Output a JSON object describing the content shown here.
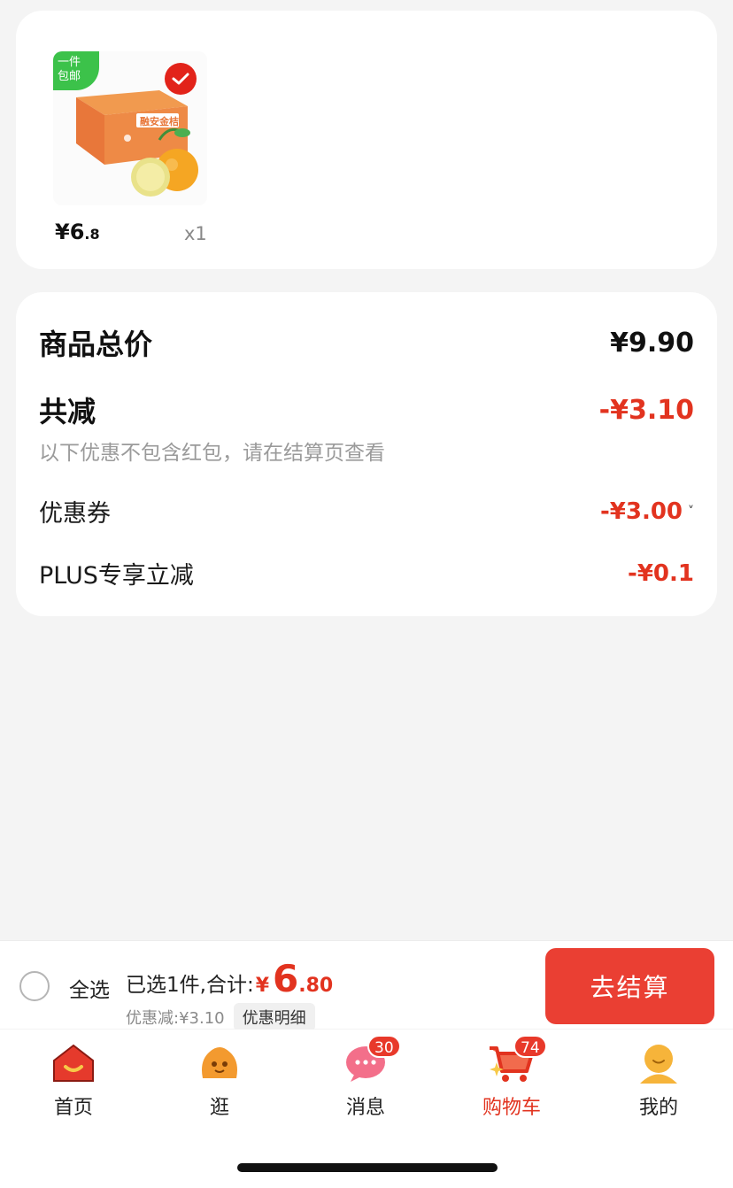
{
  "product": {
    "badge_line1": "一件",
    "badge_line2": "包邮",
    "price_symbol": "¥",
    "price_int": "6",
    "price_dec": ".8",
    "quantity": "x1",
    "package_text": "融安金桔"
  },
  "summary": {
    "total_label": "商品总价",
    "total_value": "¥9.90",
    "reduce_label": "共减",
    "reduce_value": "-¥3.10",
    "reduce_note": "以下优惠不包含红包，请在结算页查看",
    "coupon_label": "优惠券",
    "coupon_value": "-¥3.00",
    "coupon_chevron": "˅",
    "plus_label": "PLUS专享立减",
    "plus_value": "-¥0.1"
  },
  "checkout": {
    "select_all": "全选",
    "selected_text": "已选1件,合计:",
    "total_symbol": "¥",
    "total_int": "6",
    "total_dec": ".80",
    "discount_text": "优惠减:¥3.10",
    "detail_button": "优惠明细",
    "checkout_button": "去结算"
  },
  "tabs": [
    {
      "label": "首页",
      "icon": "home-icon"
    },
    {
      "label": "逛",
      "icon": "browse-icon"
    },
    {
      "label": "消息",
      "icon": "message-icon",
      "badge": "30"
    },
    {
      "label": "购物车",
      "icon": "cart-icon",
      "badge": "74",
      "active": true
    },
    {
      "label": "我的",
      "icon": "profile-icon"
    }
  ],
  "colors": {
    "accent": "#e2331f",
    "checkout_button": "#ea3f33",
    "free_ship_badge": "#3cc24a"
  }
}
